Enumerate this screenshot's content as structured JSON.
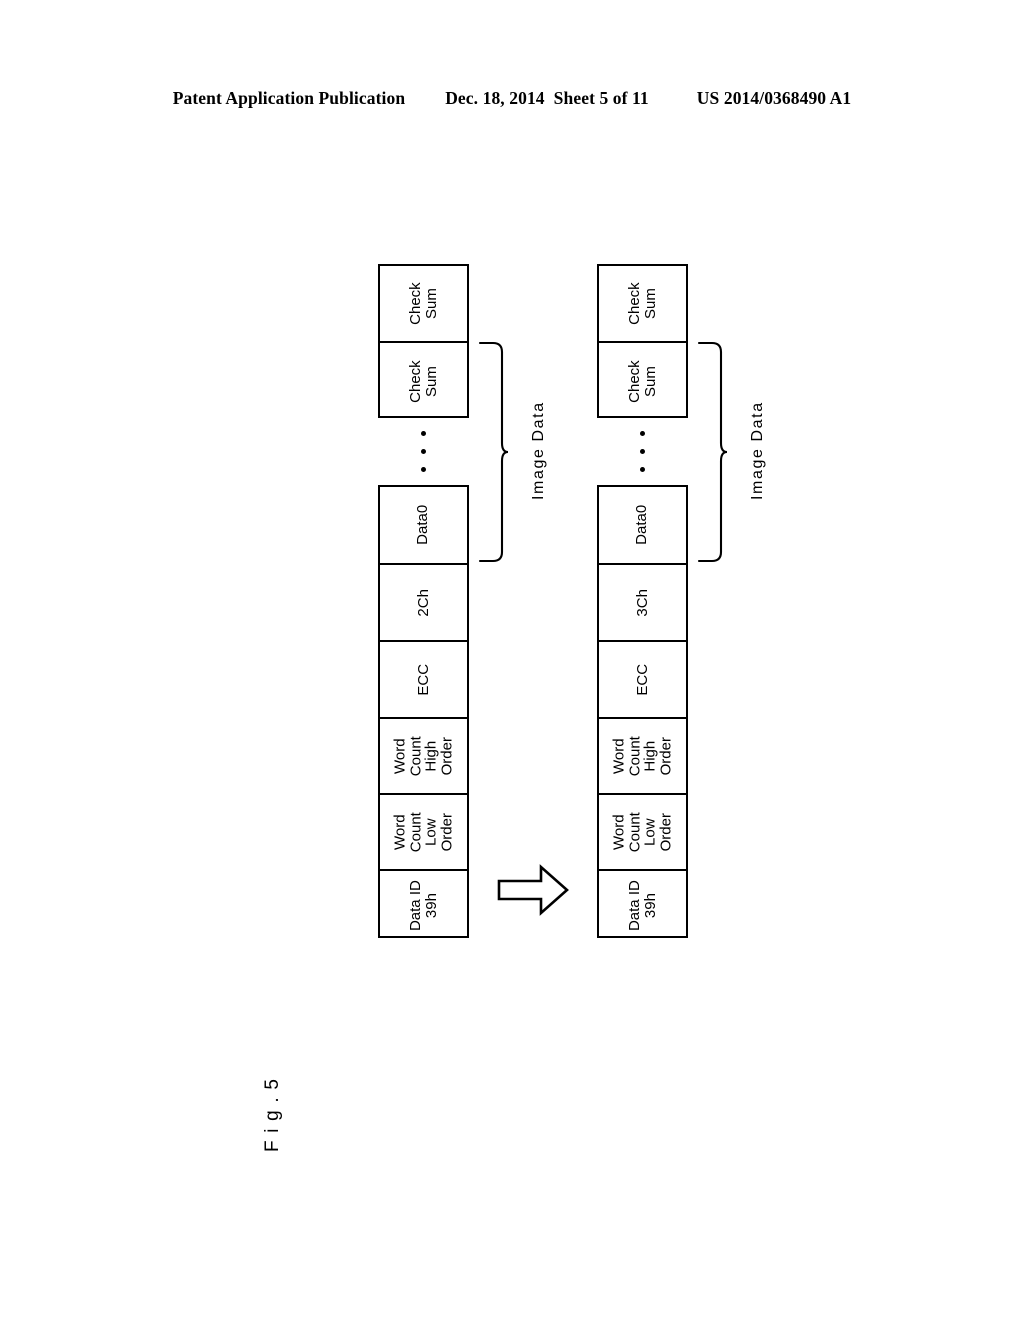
{
  "header": {
    "publication": "Patent Application Publication",
    "date": "Dec. 18, 2014",
    "sheet": "Sheet 5 of 11",
    "patent_number": "US 2014/0368490 A1"
  },
  "figure": {
    "label": "F i g . 5"
  },
  "arrow": {
    "icon": "right-arrow-icon",
    "direction": "right"
  },
  "diagrams": [
    {
      "id": "before-packet",
      "side": "left",
      "lower_cells": [
        {
          "name": "data-id",
          "lines": [
            "Data ID",
            "39h"
          ]
        },
        {
          "name": "word-count-low-order",
          "lines": [
            "Word",
            "Count",
            "Low",
            "Order"
          ]
        },
        {
          "name": "word-count-high-order",
          "lines": [
            "Word",
            "Count",
            "High",
            "Order"
          ]
        },
        {
          "name": "ecc",
          "lines": [
            "ECC"
          ]
        },
        {
          "name": "mode-code",
          "lines": [
            "2Ch"
          ]
        },
        {
          "name": "data0",
          "lines": [
            "Data0"
          ]
        }
      ],
      "ellipsis": "⋮",
      "upper_cells": [
        {
          "name": "check-sum",
          "lines": [
            "Check",
            "Sum"
          ]
        },
        {
          "name": "check-sum",
          "lines": [
            "Check",
            "Sum"
          ]
        }
      ],
      "brace_label": "Image Data"
    },
    {
      "id": "after-packet",
      "side": "right",
      "lower_cells": [
        {
          "name": "data-id",
          "lines": [
            "Data ID",
            "39h"
          ]
        },
        {
          "name": "word-count-low-order",
          "lines": [
            "Word",
            "Count",
            "Low",
            "Order"
          ]
        },
        {
          "name": "word-count-high-order",
          "lines": [
            "Word",
            "Count",
            "High",
            "Order"
          ]
        },
        {
          "name": "ecc",
          "lines": [
            "ECC"
          ]
        },
        {
          "name": "mode-code",
          "lines": [
            "3Ch"
          ]
        },
        {
          "name": "data0",
          "lines": [
            "Data0"
          ]
        }
      ],
      "ellipsis": "⋮",
      "upper_cells": [
        {
          "name": "check-sum",
          "lines": [
            "Check",
            "Sum"
          ]
        },
        {
          "name": "check-sum",
          "lines": [
            "Check",
            "Sum"
          ]
        }
      ],
      "brace_label": "Image Data"
    }
  ],
  "colors": {
    "ink": "#000000",
    "paper": "#ffffff"
  }
}
